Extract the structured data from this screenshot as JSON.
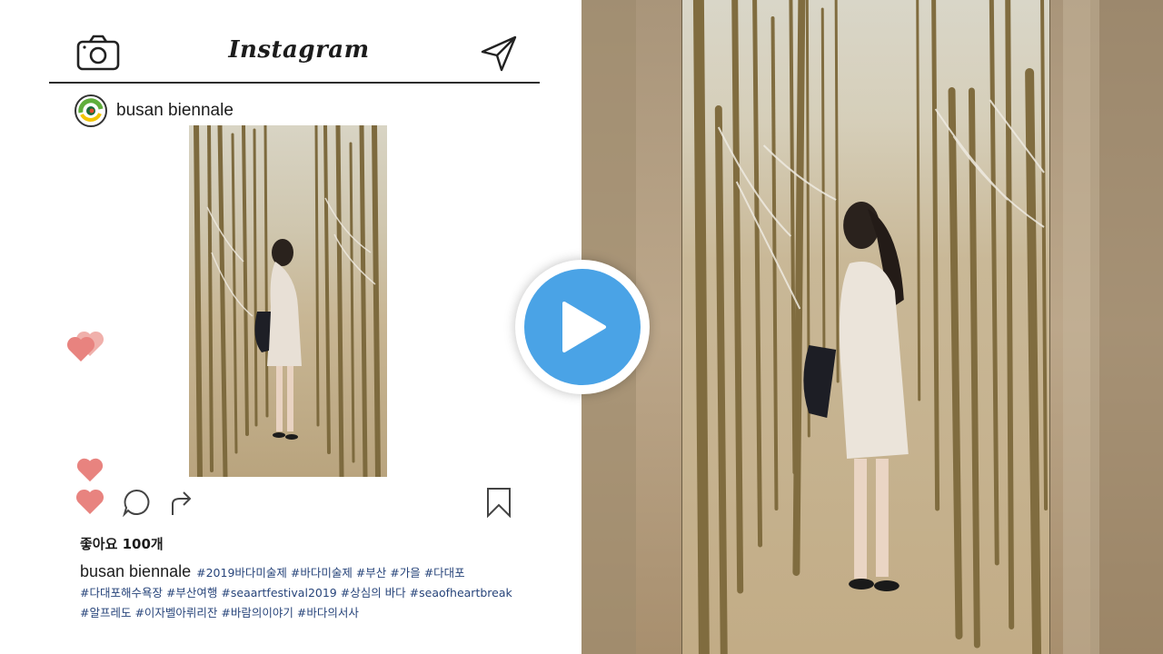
{
  "app": {
    "brand": "Instagram"
  },
  "post": {
    "username": "busan biennale",
    "likes": "좋아요 100개",
    "caption_user": "busan biennale",
    "hashtag_lines": [
      "#2019바다미술제 #바다미술제 #부산 #가을 #다대포",
      "#다대포해수욕장 #부산여행 #seaartfestival2019 #상심의 바다 #seaofheartbreak",
      "#알프레도 #이자벨아뤼리잔 #바람의이야기 #바다의서사"
    ]
  },
  "icons": {
    "camera": "camera-icon",
    "send": "send-icon",
    "like": "heart-icon",
    "comment": "comment-icon",
    "share": "share-icon",
    "bookmark": "bookmark-icon",
    "play": "play-icon"
  },
  "colors": {
    "heart": "#e8837f",
    "heart_light": "#f0b0ab",
    "hashtag": "#27447a",
    "play": "#4aa3e6",
    "sand": "#c9b89a",
    "bamboo": "#8c7a4e"
  }
}
